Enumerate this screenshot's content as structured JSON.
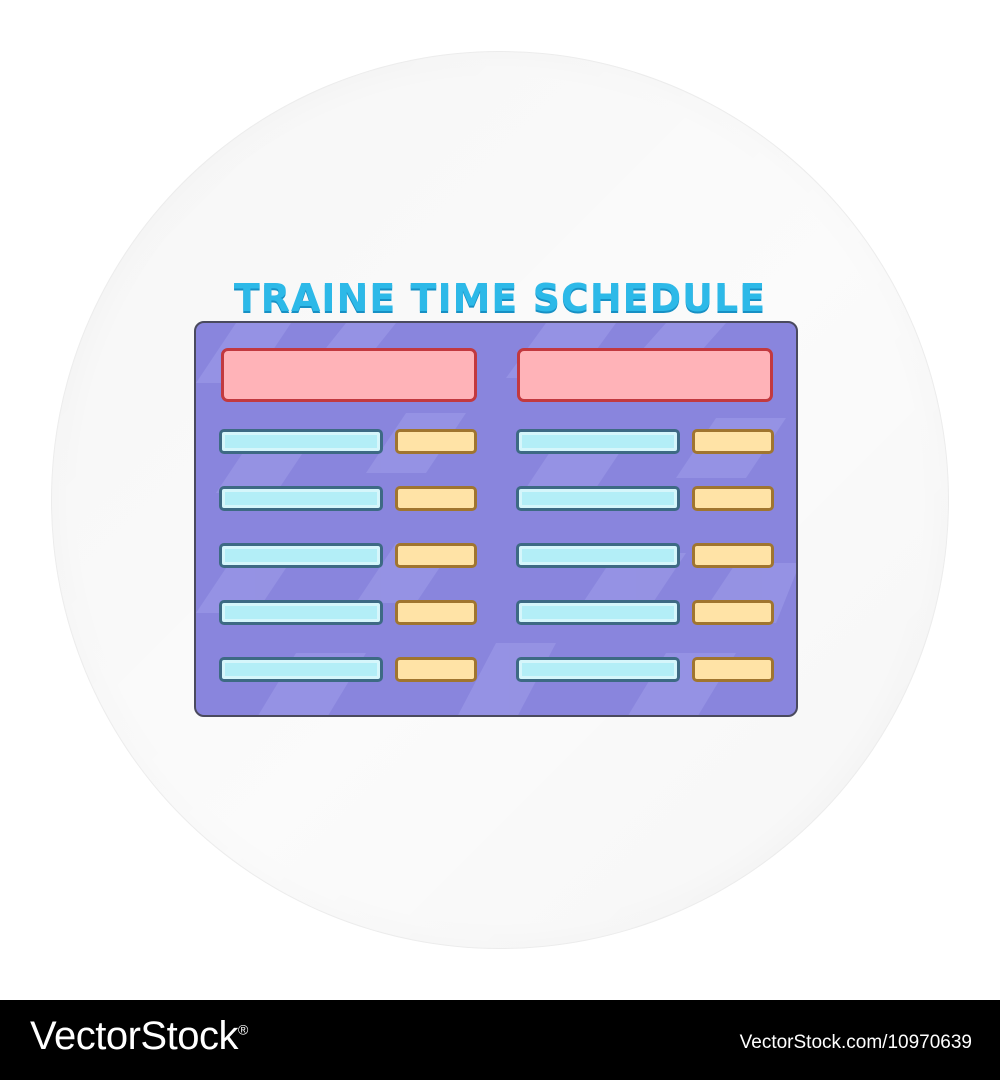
{
  "illustration": {
    "title": "TRAINE TIME SCHEDULE",
    "colors": {
      "circle": "#f6f6f6",
      "board": "#8985dd",
      "title": "#2db9e8",
      "header_fill": "#ffb3b8",
      "header_border": "#c2393f",
      "row_fill": "#b3eef7",
      "row_border": "#3d6a84",
      "time_fill": "#ffe3a6",
      "time_border": "#a0752f"
    },
    "columns": 2,
    "rows_per_column": 5
  },
  "footer": {
    "brand": "VectorStock",
    "brand_mark": "®",
    "url": "VectorStock.com/10970639"
  }
}
